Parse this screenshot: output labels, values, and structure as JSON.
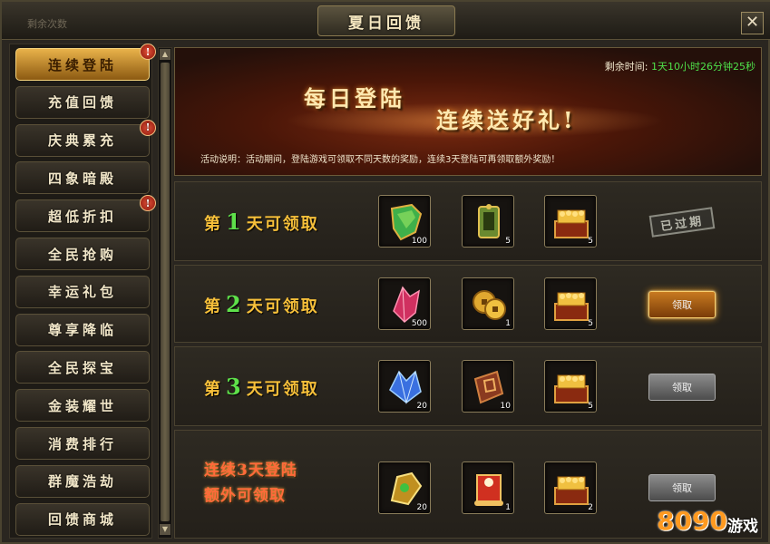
{
  "window": {
    "title": "夏日回馈",
    "ghost_text": "剩余次数",
    "close_glyph": "✕"
  },
  "sidebar": {
    "items": [
      {
        "label": "连续登陆",
        "active": true,
        "badge": "!"
      },
      {
        "label": "充值回馈",
        "active": false,
        "badge": ""
      },
      {
        "label": "庆典累充",
        "active": false,
        "badge": "!"
      },
      {
        "label": "四象暗殿",
        "active": false,
        "badge": ""
      },
      {
        "label": "超低折扣",
        "active": false,
        "badge": "!"
      },
      {
        "label": "全民抢购",
        "active": false,
        "badge": ""
      },
      {
        "label": "幸运礼包",
        "active": false,
        "badge": ""
      },
      {
        "label": "尊享降临",
        "active": false,
        "badge": ""
      },
      {
        "label": "全民探宝",
        "active": false,
        "badge": ""
      },
      {
        "label": "金装耀世",
        "active": false,
        "badge": ""
      },
      {
        "label": "消费排行",
        "active": false,
        "badge": ""
      },
      {
        "label": "群魔浩劫",
        "active": false,
        "badge": ""
      },
      {
        "label": "回馈商城",
        "active": false,
        "badge": ""
      }
    ]
  },
  "banner": {
    "title1": "每日登陆",
    "title2": "连续送好礼!",
    "timer_label": "剩余时间:",
    "timer_value": "1天10小时26分钟25秒",
    "description": "活动说明：活动期间，登陆游戏可领取不同天数的奖励，连续3天登陆可再领取额外奖励！"
  },
  "rows": [
    {
      "prefix": "第",
      "num": "1",
      "suffix": "天可领取",
      "items": [
        {
          "icon": "green-gold-armor-icon",
          "qty": "100"
        },
        {
          "icon": "jade-token-icon",
          "qty": "5"
        },
        {
          "icon": "gold-treasure-chest-icon",
          "qty": "5"
        }
      ],
      "action": {
        "type": "stamp",
        "label": "已过期"
      }
    },
    {
      "prefix": "第",
      "num": "2",
      "suffix": "天可领取",
      "items": [
        {
          "icon": "red-crystal-icon",
          "qty": "500"
        },
        {
          "icon": "gold-coins-icon",
          "qty": "1"
        },
        {
          "icon": "gold-treasure-chest-icon",
          "qty": "5"
        }
      ],
      "action": {
        "type": "gold",
        "label": "领取"
      }
    },
    {
      "prefix": "第",
      "num": "3",
      "suffix": "天可领取",
      "items": [
        {
          "icon": "blue-crystal-icon",
          "qty": "20"
        },
        {
          "icon": "rune-stone-icon",
          "qty": "10"
        },
        {
          "icon": "gold-treasure-chest-icon",
          "qty": "5"
        }
      ],
      "action": {
        "type": "gray",
        "label": "领取"
      }
    }
  ],
  "bonus_row": {
    "line1": "连续3天登陆",
    "line2": "额外可领取",
    "items": [
      {
        "icon": "golden-gem-piece-icon",
        "qty": "20"
      },
      {
        "icon": "red-scroll-icon",
        "qty": "1"
      },
      {
        "icon": "gold-treasure-chest-icon",
        "qty": "2"
      }
    ],
    "action": {
      "type": "gray",
      "label": "领取"
    }
  },
  "watermark": {
    "digits": "8090",
    "text": "游戏"
  }
}
